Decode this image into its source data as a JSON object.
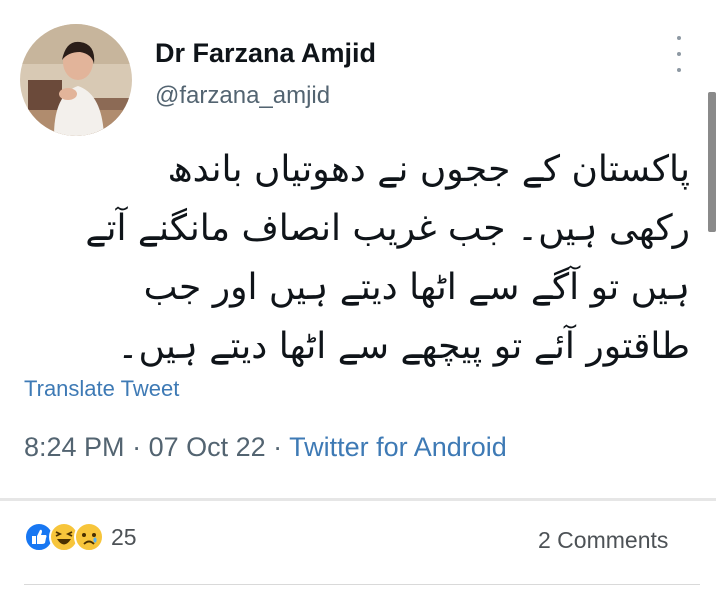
{
  "tweet": {
    "display_name": "Dr Farzana Amjid",
    "handle": "@farzana_amjid",
    "text_lines": [
      "پاکستان کے ججوں نے دھوتیاں باندھ",
      "رکھی ہیں۔ جب غریب انصاف مانگنے آتے",
      "ہیں تو آگے سے اٹھا دیتے ہیں اور جب",
      "طاقتور آئے تو پیچھے سے اٹھا دیتے ہیں۔"
    ],
    "translate_label": "Translate Tweet",
    "time": "8:24 PM",
    "date": "07 Oct 22",
    "source": "Twitter for Android",
    "separator": " · "
  },
  "post_footer": {
    "reaction_count": "25",
    "comments_label": "2 Comments",
    "reactions": [
      "like-icon",
      "haha-icon",
      "sad-icon"
    ]
  },
  "colors": {
    "text": "#0f1419",
    "secondary": "#536471",
    "link": "#3e7ab5",
    "like": "#1877f2",
    "emoji": "#f7c53b"
  }
}
